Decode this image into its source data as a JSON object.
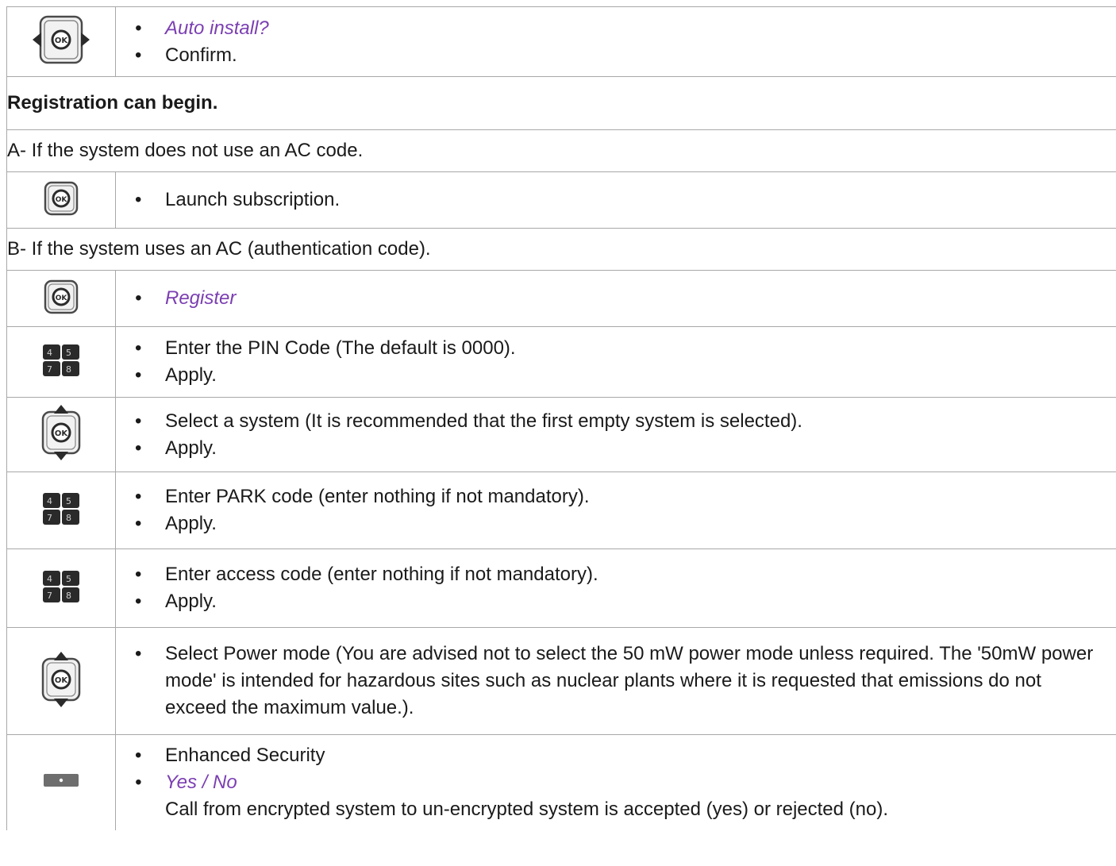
{
  "rows": {
    "auto_install": {
      "icon": "navigator-left-right-ok-icon",
      "items": [
        "Auto install?",
        "Confirm."
      ]
    },
    "registration_header": "Registration can begin.",
    "section_a": "A- If the system does not use an AC code.",
    "launch": {
      "icon": "ok-button-icon",
      "items": [
        "Launch subscription."
      ]
    },
    "section_b": "B- If the system uses an AC (authentication code).",
    "register": {
      "icon": "ok-button-icon",
      "items": [
        "Register"
      ]
    },
    "pin": {
      "icon": "keypad-icon",
      "items": [
        "Enter the PIN Code (The default is 0000).",
        "Apply."
      ]
    },
    "select_system": {
      "icon": "navigator-up-down-ok-icon",
      "items": [
        "Select a system (It is recommended that the first empty system is selected).",
        "Apply."
      ]
    },
    "park": {
      "icon": "keypad-icon",
      "items": [
        "Enter PARK code (enter nothing if not mandatory).",
        "Apply."
      ]
    },
    "access": {
      "icon": "keypad-icon",
      "items": [
        "Enter access code (enter nothing if not mandatory).",
        "Apply."
      ]
    },
    "power": {
      "icon": "navigator-up-down-ok-icon",
      "items": [
        "Select Power mode (You are advised not to select the 50 mW power mode unless required. The '50mW power mode' is intended for hazardous sites such as nuclear plants where it is requested that emissions do not exceed the maximum value.)."
      ]
    },
    "security": {
      "icon": "softkey-icon",
      "items": [
        "Enhanced Security",
        "Yes / No"
      ],
      "note": "Call from encrypted system to un-encrypted system is accepted (yes) or rejected (no)."
    }
  },
  "colors": {
    "accent_purple": "#7b3fb2",
    "border": "#a8a8a8"
  }
}
